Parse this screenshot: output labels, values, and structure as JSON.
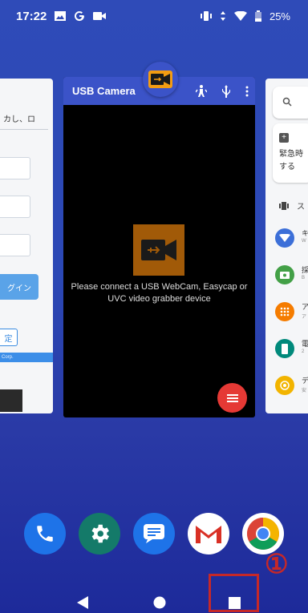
{
  "status_bar": {
    "time": "17:22",
    "left_icons": [
      "image-icon",
      "google-icon",
      "video-icon"
    ],
    "right_icons": [
      "vibrate-icon",
      "data-arrows-icon",
      "wifi-icon",
      "battery-icon"
    ],
    "battery": "25%"
  },
  "left_card": {
    "text": "カし、ロ",
    "login_label": "グイン",
    "setting_label": "定",
    "footer": "Corp."
  },
  "main_card": {
    "app_name": "USB Camera",
    "actions": [
      "walk-icon",
      "usb-icon",
      "more-vert-icon"
    ],
    "message": "Please connect a USB WebCam, Easycap or\nUVC video grabber device",
    "fab": "menu-icon"
  },
  "right_card": {
    "search_text": "Q",
    "notice_text": "緊急時\nする",
    "section_label": "ス",
    "apps": [
      {
        "title": "キ",
        "sub": "W",
        "color": "#3c6fd8"
      },
      {
        "title": "採",
        "sub": "B",
        "color": "#43a047"
      },
      {
        "title": "ア",
        "sub": "ア",
        "color": "#f57c00"
      },
      {
        "title": "電",
        "sub": "2",
        "color": "#00897b"
      },
      {
        "title": "デ",
        "sub": "安",
        "color": "#f2b400"
      }
    ]
  },
  "dock": [
    {
      "name": "phone",
      "color": "#1e73e8"
    },
    {
      "name": "settings",
      "color": "#147a69"
    },
    {
      "name": "messages",
      "color": "#1e73e8"
    },
    {
      "name": "gmail",
      "color": "#ffffff"
    },
    {
      "name": "chrome",
      "color": "#ffffff"
    }
  ],
  "annotation": "①",
  "colors": {
    "accent": "#3b53c8",
    "highlight": "#c62828",
    "fab": "#e53935"
  }
}
